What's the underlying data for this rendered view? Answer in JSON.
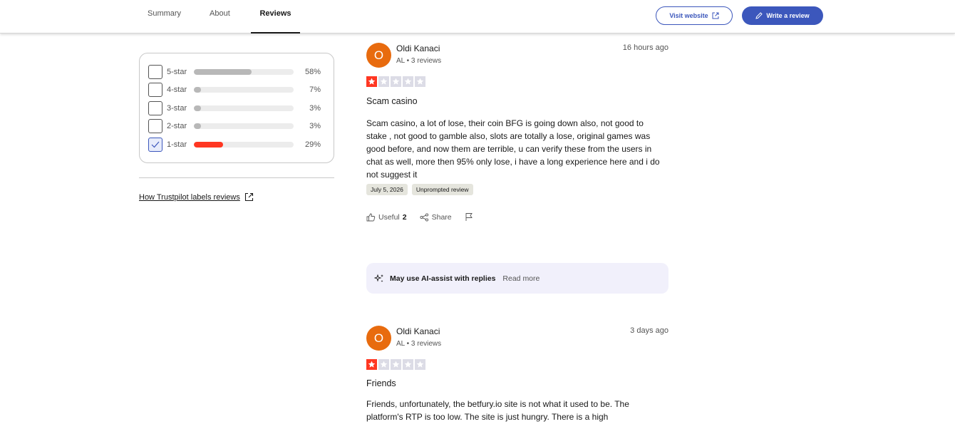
{
  "nav": {
    "tabs": [
      {
        "label": "Summary"
      },
      {
        "label": "About"
      },
      {
        "label": "Reviews"
      }
    ],
    "visit_label": "Visit website",
    "write_label": "Write a review"
  },
  "filter": {
    "rows": [
      {
        "label": "5-star",
        "pct": "58%",
        "fill": 0.58,
        "checked": false
      },
      {
        "label": "4-star",
        "pct": "7%",
        "fill": 0.07,
        "checked": false
      },
      {
        "label": "3-star",
        "pct": "3%",
        "fill": 0.03,
        "checked": false
      },
      {
        "label": "2-star",
        "pct": "3%",
        "fill": 0.03,
        "checked": false
      },
      {
        "label": "1-star",
        "pct": "29%",
        "fill": 0.29,
        "checked": true
      }
    ],
    "labels_link": "How Trustpilot labels reviews"
  },
  "reviews": [
    {
      "avatar_letter": "O",
      "name": "Oldi Kanaci",
      "meta": "AL • 3 reviews",
      "date": "16 hours ago",
      "rating": 1,
      "title": "Scam casino",
      "body": "Scam casino, a lot of lose, their coin BFG is going down also, not good to stake , not good to gamble also, slots are totally a lose, original games was good before, and now them are terrible, u can verify these from the users in chat as well, more then 95% only lose, i have a long experience here and i do not suggest it",
      "tags": [
        "July 5, 2026",
        "Unprompted review"
      ],
      "useful_label": "Useful",
      "useful_count": "2",
      "share_label": "Share"
    },
    {
      "avatar_letter": "O",
      "name": "Oldi Kanaci",
      "meta": "AL • 3 reviews",
      "date": "3 days ago",
      "rating": 1,
      "title": "Friends",
      "body": "Friends, unfortunately, the betfury.io site is not what it used to be. The platform's RTP is too low. The site is just hungry. There is a high"
    }
  ],
  "ai_notice": {
    "text": "May use AI-assist with replies",
    "link": "Read more"
  },
  "colors": {
    "brand_blue": "#3c57bc",
    "star_red": "#ff3722",
    "avatar_orange": "#e86b0e",
    "ai_bg": "#f1f0fb"
  }
}
